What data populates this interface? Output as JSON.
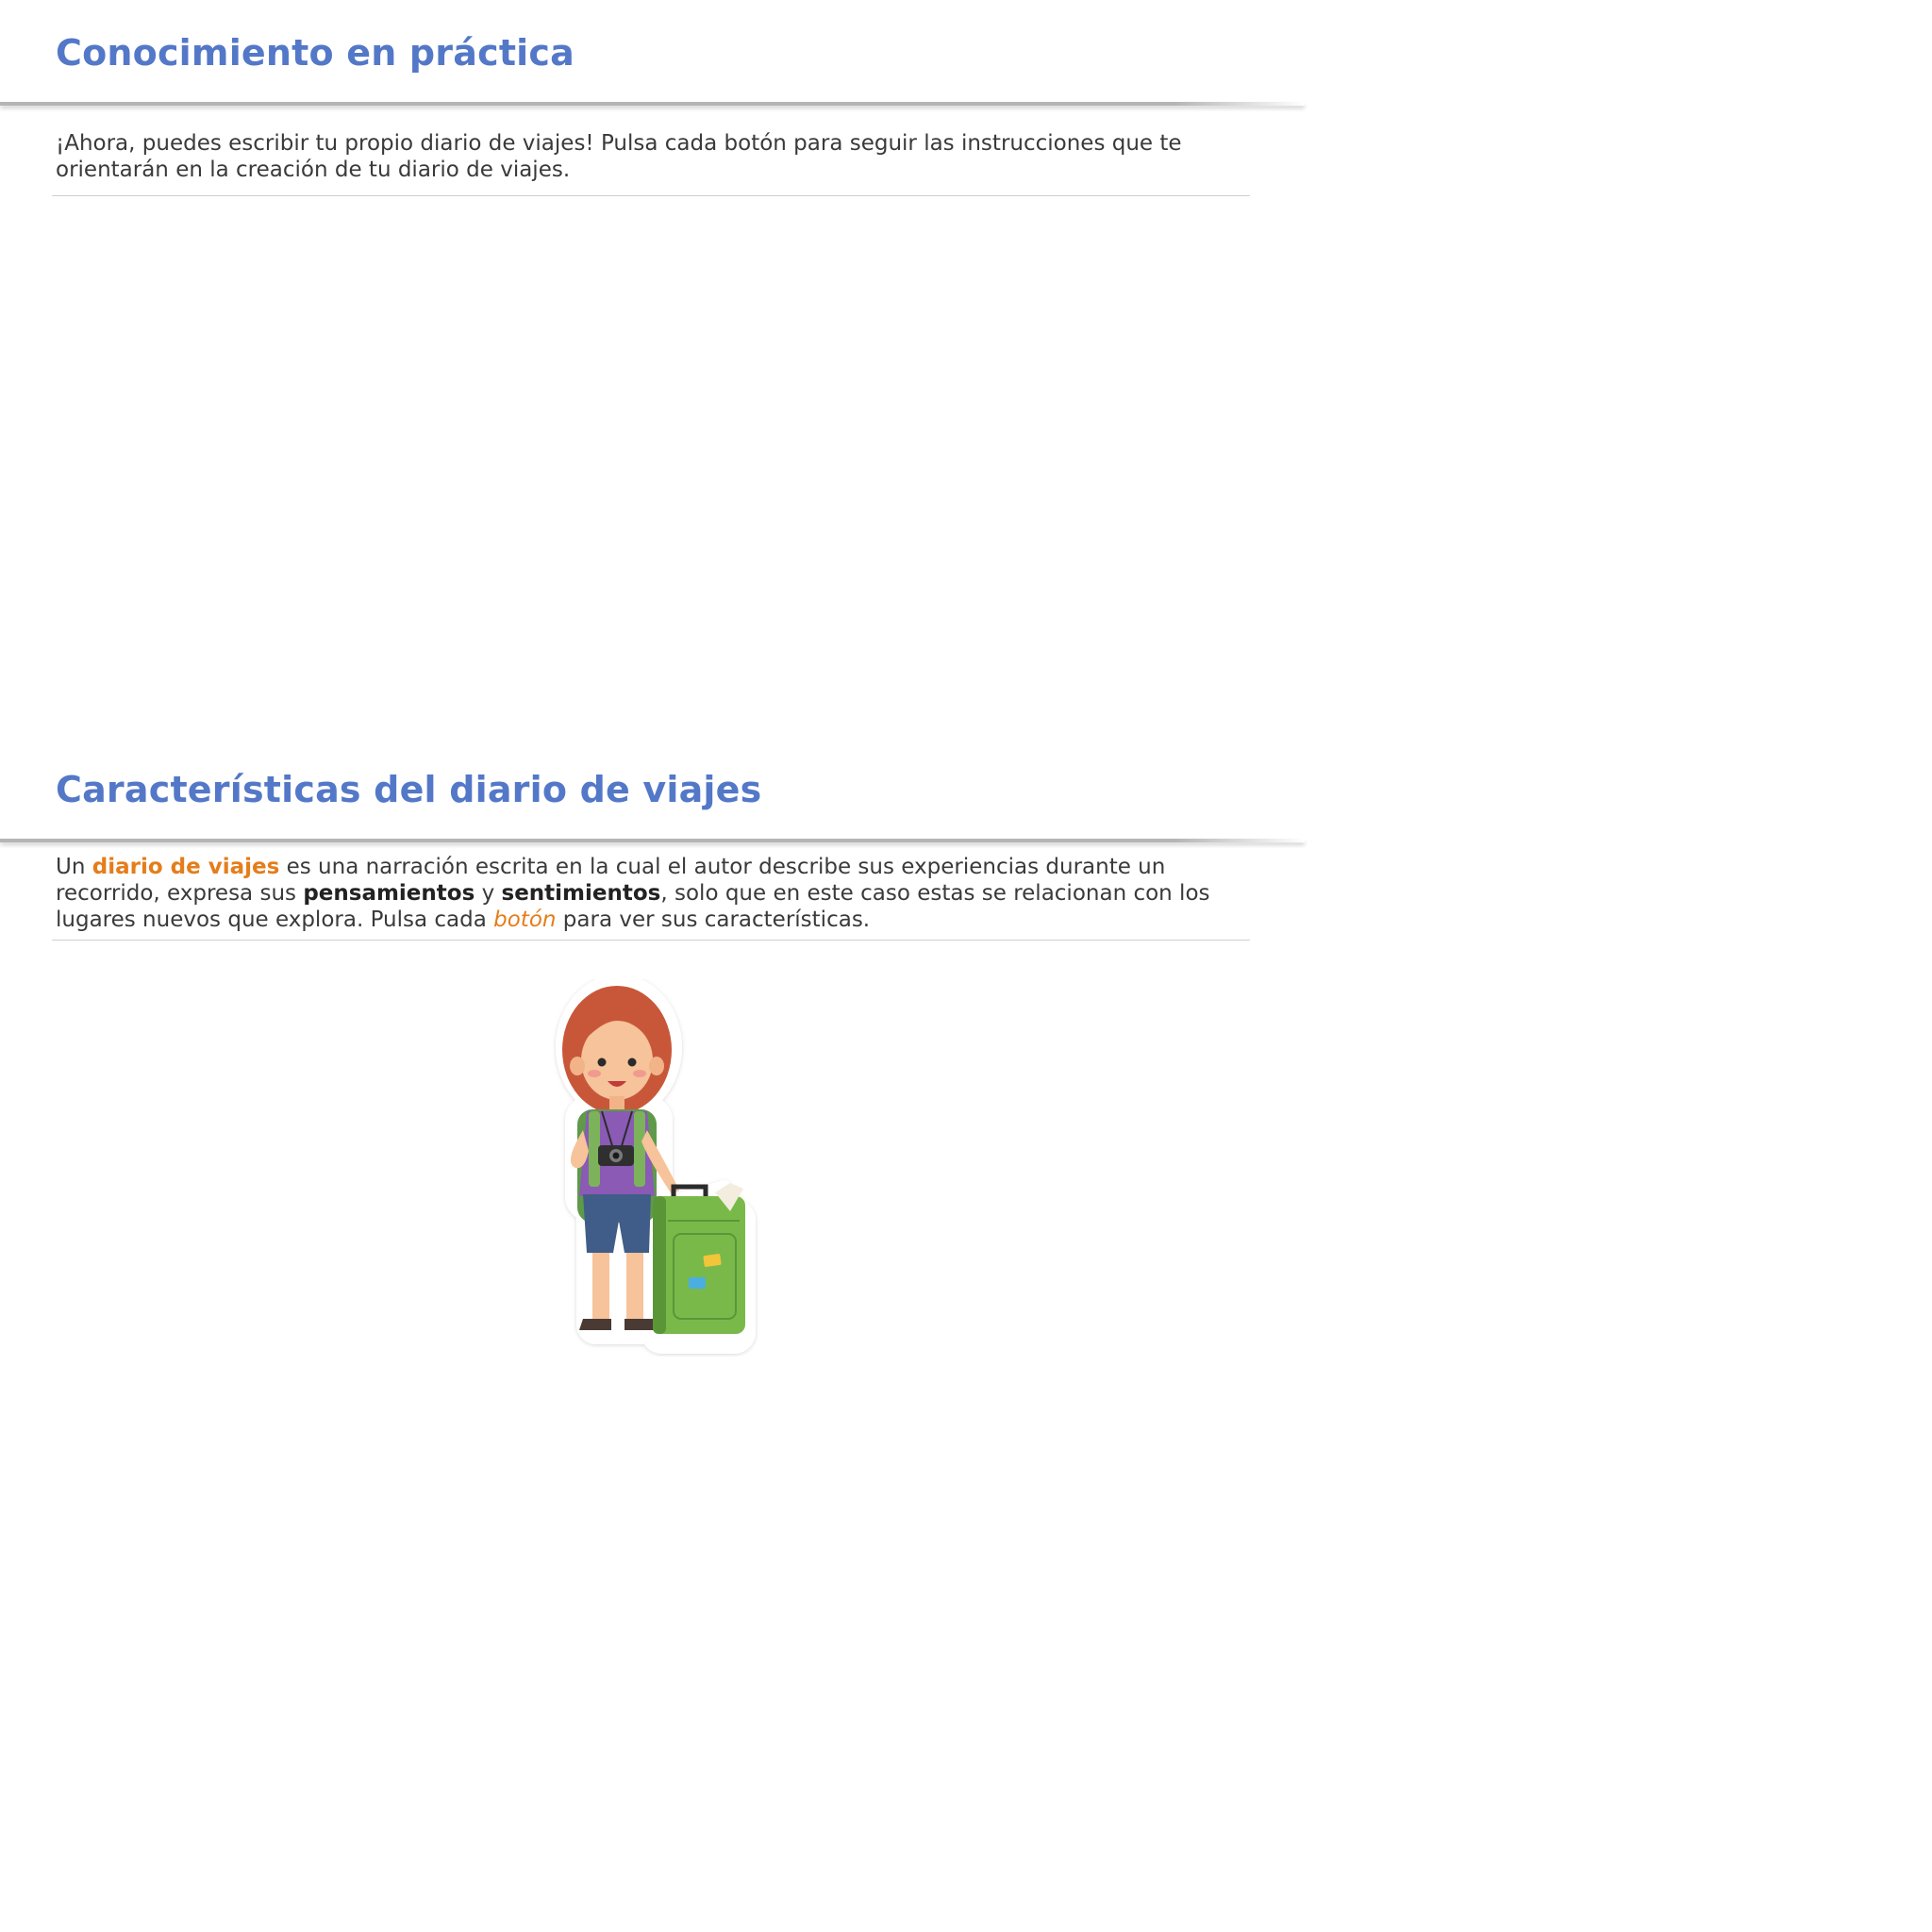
{
  "section1": {
    "title": "Conocimiento en práctica",
    "body": "¡Ahora, puedes escribir tu propio diario de viajes! Pulsa cada botón para seguir las instrucciones que te orientarán en la creación de tu diario de viajes."
  },
  "section2": {
    "title": "Características del diario de viajes",
    "body": {
      "t1": "Un ",
      "term": "diario de viajes",
      "t2": " es una narración escrita en la cual el autor describe sus experiencias durante un recorrido, expresa sus ",
      "b1": "pensamientos",
      "t3": " y ",
      "b2": "sentimientos",
      "t4": ", solo que en este caso estas se relacionan con los lugares nuevos que explora. Pulsa cada ",
      "link": "botón",
      "t5": " para ver sus características."
    }
  },
  "illustration": {
    "icon": "traveler-girl-icon"
  },
  "colors": {
    "title": "#5478c8",
    "accent": "#e57d1a",
    "text": "#3a3a3a"
  }
}
